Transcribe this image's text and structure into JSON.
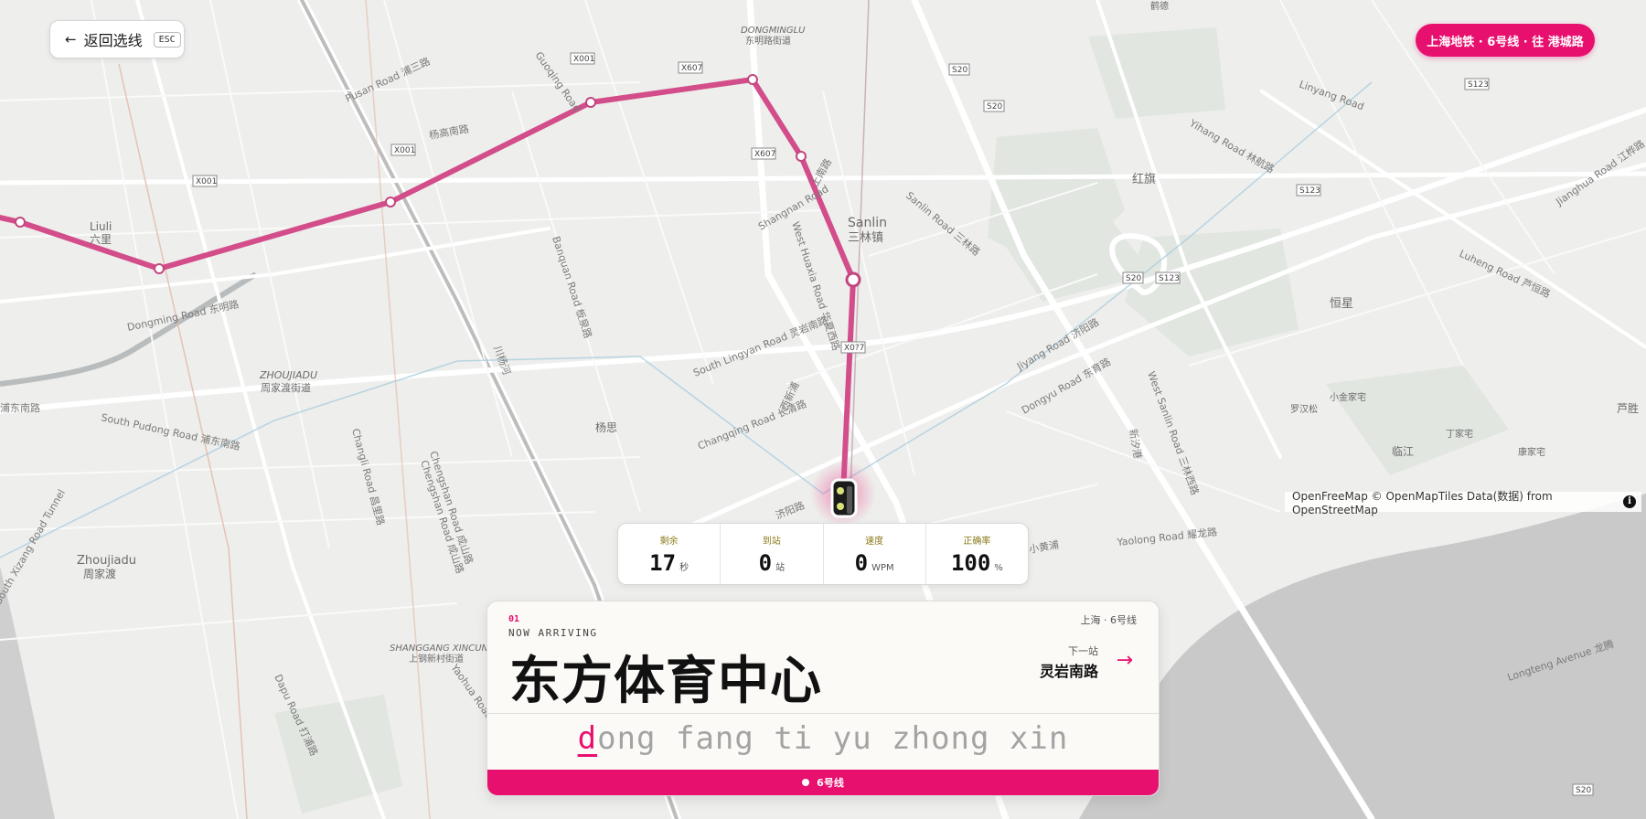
{
  "back_button": {
    "label": "返回选线",
    "shortcut": "ESC",
    "icon": "arrow-left-icon"
  },
  "line_badge": {
    "text": "上海地铁 · 6号线 · 往 港城路",
    "color": "#e8106f"
  },
  "map": {
    "places": [
      "DONGMINGLU",
      "东明路街道",
      "Liuli",
      "六里",
      "Sanlin",
      "三林镇",
      "红旗",
      "恒星",
      "ZHOUJIADU",
      "周家渡街道",
      "杨思",
      "Zhoujiadu",
      "周家渡",
      "SHANGGANG XINCUN",
      "上钢新村街道",
      "罗汉松",
      "小金家宅",
      "丁家宅",
      "临江",
      "康家宅",
      "芦胜",
      "鹤德"
    ],
    "roads": [
      "Dongming Road 东明路",
      "Pusan Road 浦三路",
      "杨高南路",
      "Chengshan Road 成山路",
      "South Pudong Road 浦东南路",
      "Changqing Road 长清路",
      "South Lingyan Road 灵岩南路",
      "Banquan Road 板泉路",
      "West Huaxia Road 华夏西路",
      "Shangnan Road",
      "上南路",
      "Sanlin Road 三林路",
      "Jiyang Road 济阳路",
      "Dongyu Road 东育路",
      "West Sanlin Road 三林西路",
      "Yaolong Road 耀龙路",
      "Yihang Road 林航路",
      "Linyang Road",
      "Luheng Road 芦恒路",
      "Jianghua Road 江桦路",
      "Longteng Avenue 龙腾",
      "济阳路",
      "Changli Road 昌里路",
      "Chengshan Road 成山路",
      "Yaohua Road",
      "South Xizang Road Tunnel",
      "Guoqing Road",
      "Dapu Road 打浦路",
      "浦东南路",
      "小黄浦",
      "川杨河",
      "西新浦",
      "新汐港"
    ],
    "shields": [
      "X001",
      "X607",
      "S20",
      "S123",
      "X0?7"
    ],
    "line_color": "#e8106f"
  },
  "attribution": {
    "text": "OpenFreeMap © OpenMapTiles Data(数据) from OpenStreetMap",
    "icon": "info-icon"
  },
  "stats": [
    {
      "label": "剩余",
      "value": "17",
      "unit": "秒"
    },
    {
      "label": "到站",
      "value": "0",
      "unit": "站"
    },
    {
      "label": "速度",
      "value": "0",
      "unit": "WPM"
    },
    {
      "label": "正确率",
      "value": "100",
      "unit": "%"
    }
  ],
  "card": {
    "index": "01",
    "status": "NOW ARRIVING",
    "city_line": "上海 · 6号线",
    "station_name": "东方体育中心",
    "next_label": "下一站",
    "next_station": "灵岩南路",
    "next_icon": "arrow-right-icon",
    "pinyin_typed": "d",
    "pinyin_rest": "ong fang ti yu zhong xin",
    "footer_line": "6号线"
  }
}
